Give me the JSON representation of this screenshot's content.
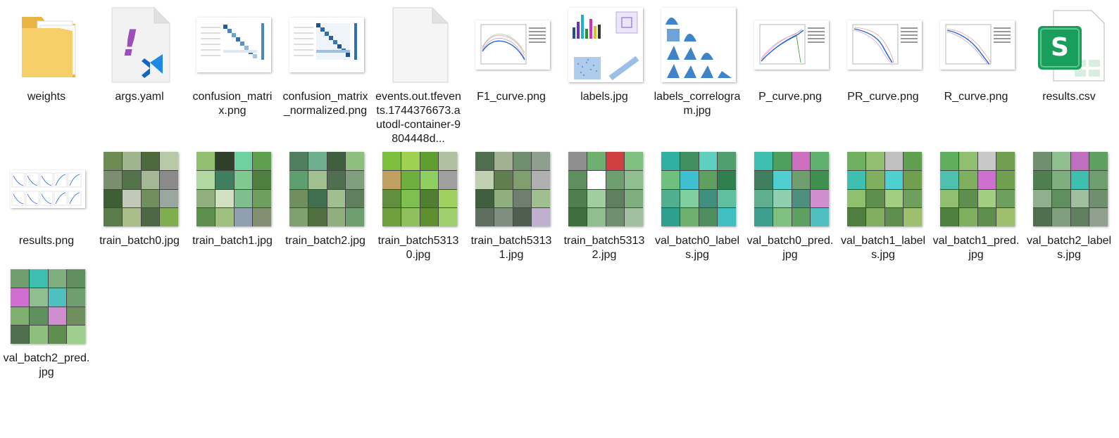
{
  "files": [
    {
      "name": "weights",
      "kind": "folder"
    },
    {
      "name": "args.yaml",
      "kind": "yaml"
    },
    {
      "name": "confusion_matrix.png",
      "kind": "matrix"
    },
    {
      "name": "confusion_matrix_normalized.png",
      "kind": "matrix"
    },
    {
      "name": "events.out.tfevents.1744376673.autodl-container-9804448d...",
      "kind": "blank"
    },
    {
      "name": "F1_curve.png",
      "kind": "curve"
    },
    {
      "name": "labels.jpg",
      "kind": "labels"
    },
    {
      "name": "labels_correlogram.jpg",
      "kind": "correlogram"
    },
    {
      "name": "P_curve.png",
      "kind": "curve"
    },
    {
      "name": "PR_curve.png",
      "kind": "curve"
    },
    {
      "name": "R_curve.png",
      "kind": "curve"
    },
    {
      "name": "results.csv",
      "kind": "csv"
    },
    {
      "name": "results.png",
      "kind": "results"
    },
    {
      "name": "train_batch0.jpg",
      "kind": "mosaic"
    },
    {
      "name": "train_batch1.jpg",
      "kind": "mosaic"
    },
    {
      "name": "train_batch2.jpg",
      "kind": "mosaic"
    },
    {
      "name": "train_batch53130.jpg",
      "kind": "mosaic"
    },
    {
      "name": "train_batch53131.jpg",
      "kind": "mosaic"
    },
    {
      "name": "train_batch53132.jpg",
      "kind": "mosaic"
    },
    {
      "name": "val_batch0_labels.jpg",
      "kind": "valmosaic"
    },
    {
      "name": "val_batch0_pred.jpg",
      "kind": "valmosaic"
    },
    {
      "name": "val_batch1_labels.jpg",
      "kind": "valmosaic"
    },
    {
      "name": "val_batch1_pred.jpg",
      "kind": "valmosaic"
    },
    {
      "name": "val_batch2_labels.jpg",
      "kind": "valmosaic"
    },
    {
      "name": "val_batch2_pred.jpg",
      "kind": "valmosaic"
    }
  ],
  "icons": {
    "folder": "folder-icon",
    "yaml": "vscode-yaml-icon",
    "csv": "spreadsheet-icon"
  },
  "csv_letter": "S",
  "yaml_glyph": "!",
  "colors": {
    "folder": "#f2c55c",
    "csv_green": "#1a9e5c",
    "yaml_purple": "#9b4fb8",
    "vscode_blue": "#1e88e5",
    "plot_blue": "#1f5fd6"
  }
}
